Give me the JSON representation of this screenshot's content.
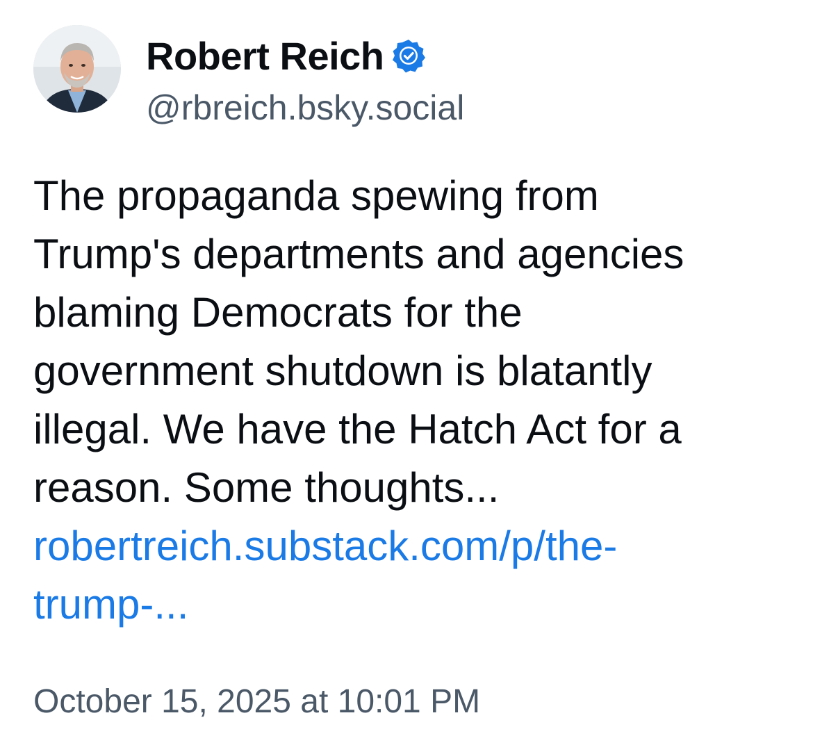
{
  "author": {
    "display_name": "Robert Reich",
    "handle": "@rbreich.bsky.social",
    "verified": true,
    "avatar_icon": "person-portrait-avatar"
  },
  "post": {
    "text_lines": [
      "The propaganda spewing from",
      "Trump's departments and agencies",
      "blaming Democrats for the",
      "government shutdown is blatantly",
      "illegal. We have the Hatch Act for a",
      "reason. Some thoughts..."
    ],
    "link_lines": [
      "robertreich.substack.com/p/the-",
      "trump-..."
    ],
    "timestamp": "October 15, 2025 at 10:01 PM"
  },
  "colors": {
    "text": "#0b0f14",
    "secondary_text": "#4a5867",
    "link": "#1a7ae6",
    "verified_badge": "#1a7ae6",
    "background": "#ffffff"
  }
}
